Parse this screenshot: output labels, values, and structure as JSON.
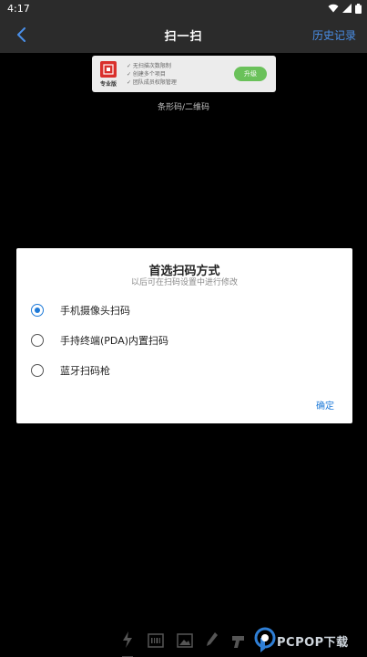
{
  "status_bar": {
    "time": "4:17"
  },
  "header": {
    "title": "扫一扫",
    "history_label": "历史记录"
  },
  "promo": {
    "badge": "专业版",
    "features": [
      "✓ 无扫描次数限制",
      "✓ 创建多个项目",
      "✓ 团队成员权限管理"
    ],
    "upgrade_label": "升级"
  },
  "scan_mode_label": "条形码/二维码",
  "dialog": {
    "title": "首选扫码方式",
    "subtitle": "以后可在扫码设置中进行修改",
    "options": [
      {
        "label": "手机摄像头扫码",
        "selected": true
      },
      {
        "label": "手持终端(PDA)内置扫码",
        "selected": false
      },
      {
        "label": "蓝牙扫码枪",
        "selected": false
      }
    ],
    "confirm_label": "确定"
  },
  "watermark": {
    "text": "PCPOP下载"
  },
  "colors": {
    "accent": "#1e7ad8",
    "header_link": "#4a8fe8",
    "upgrade": "#6ac15a",
    "logo_red": "#d9302c"
  }
}
